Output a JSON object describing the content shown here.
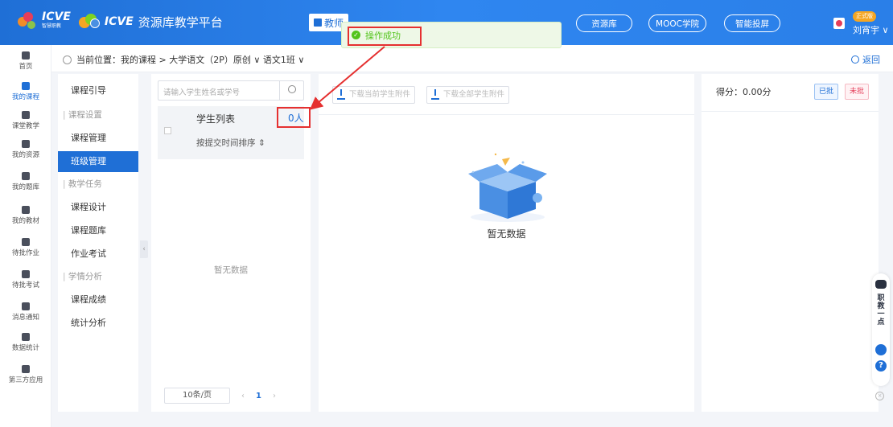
{
  "header": {
    "logo_brand": "ICVE",
    "logo_sub": "智慧职教",
    "platform_title": "资源库教学平台",
    "nav_tab": "教师",
    "links": [
      "资源库",
      "MOOC学院",
      "智能投屏"
    ],
    "vip_badge": "正式版",
    "user_name": "刘宵宇 ∨"
  },
  "toast": {
    "message": "操作成功"
  },
  "rail": [
    {
      "label": "首页",
      "icon": "home-icon"
    },
    {
      "label": "我的课程",
      "icon": "course-icon",
      "active": true
    },
    {
      "label": "课堂教学",
      "icon": "classroom-icon"
    },
    {
      "label": "我的资源",
      "icon": "resource-icon"
    },
    {
      "label": "我的题库",
      "icon": "question-bank-icon"
    },
    {
      "label": "我的教材",
      "icon": "textbook-icon"
    },
    {
      "label": "待批作业",
      "icon": "homework-icon"
    },
    {
      "label": "待批考试",
      "icon": "exam-icon"
    },
    {
      "label": "消息通知",
      "icon": "message-icon"
    },
    {
      "label": "数据统计",
      "icon": "stats-icon"
    },
    {
      "label": "第三方应用",
      "icon": "apps-icon"
    }
  ],
  "breadcrumb": {
    "text": "当前位置：我的课程 > 大学语文（2P）原创 ∨  语文1班 ∨",
    "back": "返回"
  },
  "menu": {
    "intro": "课程引导",
    "group_settings": "课程设置",
    "course_manage": "课程管理",
    "class_manage": "班级管理",
    "group_tasks": "教学任务",
    "course_design": "课程设计",
    "course_bank": "课程题库",
    "homework_exam": "作业考试",
    "group_analysis": "学情分析",
    "course_grades": "课程成绩",
    "stats_analysis": "统计分析"
  },
  "students": {
    "search_placeholder": "请输入学生姓名或学号",
    "list_title": "学生列表",
    "count": "0人",
    "sort_label": "按提交时间排序 ⇕",
    "empty": "暂无数据",
    "page_size": "10条/页",
    "page_num": "1"
  },
  "main": {
    "download_current": "下载当前学生附件",
    "download_all": "下载全部学生附件",
    "empty": "暂无数据"
  },
  "right": {
    "score": "得分：0.00分",
    "done": "已批",
    "undone": "未批"
  },
  "widget": {
    "text": "职教一点"
  }
}
